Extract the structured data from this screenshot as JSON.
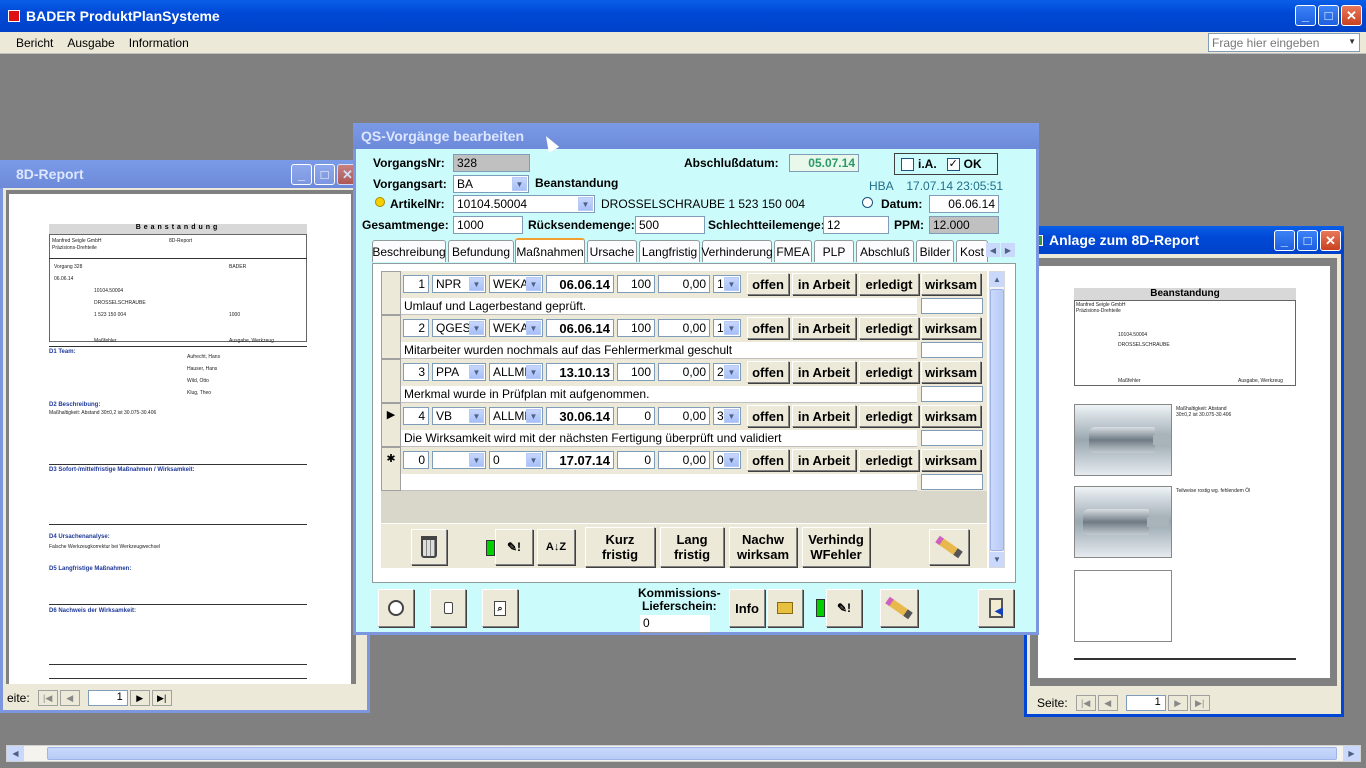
{
  "app": {
    "title": "BADER ProduktPlanSysteme",
    "menu": [
      "Bericht",
      "Ausgabe",
      "Information"
    ],
    "help_placeholder": "Frage hier eingeben"
  },
  "report_window": {
    "title": "8D-Report",
    "page_label": "eite:",
    "page_value": "1",
    "doc": {
      "header_title": "Beanstandung",
      "company": "Manfred Seigle GmbH",
      "company2": "Präzisions-Drehteile",
      "report_name": "8D-Report",
      "sections": [
        "D1 Team:",
        "D2 Beschreibung:",
        "D3 Sofort-/mittelfristige Maßnahmen / Wirksamkeit:",
        "D4 Ursachenanalyse:",
        "D5 Langfristige Maßnahmen:",
        "D6 Nachweis der Wirksamkeit:"
      ],
      "team": [
        "Aufrecht, Hans",
        "Hauser, Hans",
        "Wild, Otto",
        "Klug, Theo"
      ],
      "d2_text": "Maßhaltigkeit: Abstand 30±0,2 ist 30.075-30.406",
      "d4_text": "Falsche Werkzeugkorrektur bei Werkzeugwechsel"
    }
  },
  "qs_window": {
    "title": "QS-Vorgänge bearbeiten",
    "vorgangsnr_label": "VorgangsNr:",
    "vorgangsnr": "328",
    "vorgangsart_label": "Vorgangsart:",
    "vorgangsart": "BA",
    "vorgangsart_text": "Beanstandung",
    "abschluss_label": "Abschlußdatum:",
    "abschluss": "05.07.14",
    "ia_label": "i.A.",
    "ok_label": "OK",
    "hba_text": "HBA    17.07.14 23:05:51",
    "artikel_label": "ArtikelNr:",
    "artikel": "10104.50004",
    "artikel_text": "DROSSELSCHRAUBE 1 523 150 004",
    "datum_label": "Datum:",
    "datum": "06.06.14",
    "gesamtmenge_label": "Gesamtmenge:",
    "gesamtmenge": "1000",
    "ruecksende_label": "Rücksendemenge:",
    "ruecksende": "500",
    "schlecht_label": "Schlechtteilemenge:",
    "schlecht": "12",
    "ppm_label": "PPM:",
    "ppm": "12.000",
    "tabs": [
      "Beschreibung",
      "Befundung",
      "Maßnahmen",
      "Ursache",
      "Langfristig",
      "Verhinderung",
      "FMEA",
      "PLP",
      "Abschluß",
      "Bilder",
      "Kost"
    ],
    "status_buttons": {
      "offen": "offen",
      "in_arbeit": "in Arbeit",
      "erledigt": "erledigt",
      "wirksam": "wirksam"
    },
    "rows": [
      {
        "nr": "1",
        "code": "NPR",
        "resp": "WEKA",
        "date": "06.06.14",
        "pct": "100",
        "cost": "0,00",
        "prio": "1",
        "text": "Umlauf und Lagerbestand geprüft.",
        "marker": ""
      },
      {
        "nr": "2",
        "code": "QGES",
        "resp": "WEKA",
        "date": "06.06.14",
        "pct": "100",
        "cost": "0,00",
        "prio": "1",
        "text": "Mitarbeiter wurden nochmals auf das Fehlermerkmal geschult",
        "marker": ""
      },
      {
        "nr": "3",
        "code": "PPA",
        "resp": "ALLME",
        "date": "13.10.13",
        "pct": "100",
        "cost": "0,00",
        "prio": "2",
        "text": "Merkmal wurde in Prüfplan mit aufgenommen.",
        "marker": ""
      },
      {
        "nr": "4",
        "code": "VB",
        "resp": "ALLME",
        "date": "30.06.14",
        "pct": "0",
        "cost": "0,00",
        "prio": "3",
        "text": "Die Wirksamkeit wird mit der nächsten Fertigung überprüft und validiert",
        "marker": "▶"
      },
      {
        "nr": "0",
        "code": "",
        "resp": "0",
        "date": "17.07.14",
        "pct": "0",
        "cost": "0,00",
        "prio": "0",
        "text": "",
        "marker": "✱"
      }
    ],
    "toolbar": {
      "kurz": [
        "Kurz",
        "fristig"
      ],
      "lang": [
        "Lang",
        "fristig"
      ],
      "nachw": [
        "Nachw",
        "wirksam"
      ],
      "verhindg": [
        "Verhindg",
        "WFehler"
      ]
    },
    "bottom": {
      "kommission_label1": "Kommissions-",
      "kommission_label2": "Lieferschein:",
      "kommission_value": "0",
      "info": "Info"
    }
  },
  "anlage_window": {
    "title": "Anlage zum 8D-Report",
    "page_label": "Seite:",
    "page_value": "1",
    "doc_title": "Beanstandung",
    "photo1_caption": "Maßhaltigkeit: Abstand 30±0,2 ist 30.075-30.406",
    "photo2_caption": "Teilweise rostig wg. fehlendem Öl"
  },
  "colors": {
    "desktop": "#808080",
    "form_bg": "#ccfbfb",
    "xp_blue": "#0049d6"
  }
}
